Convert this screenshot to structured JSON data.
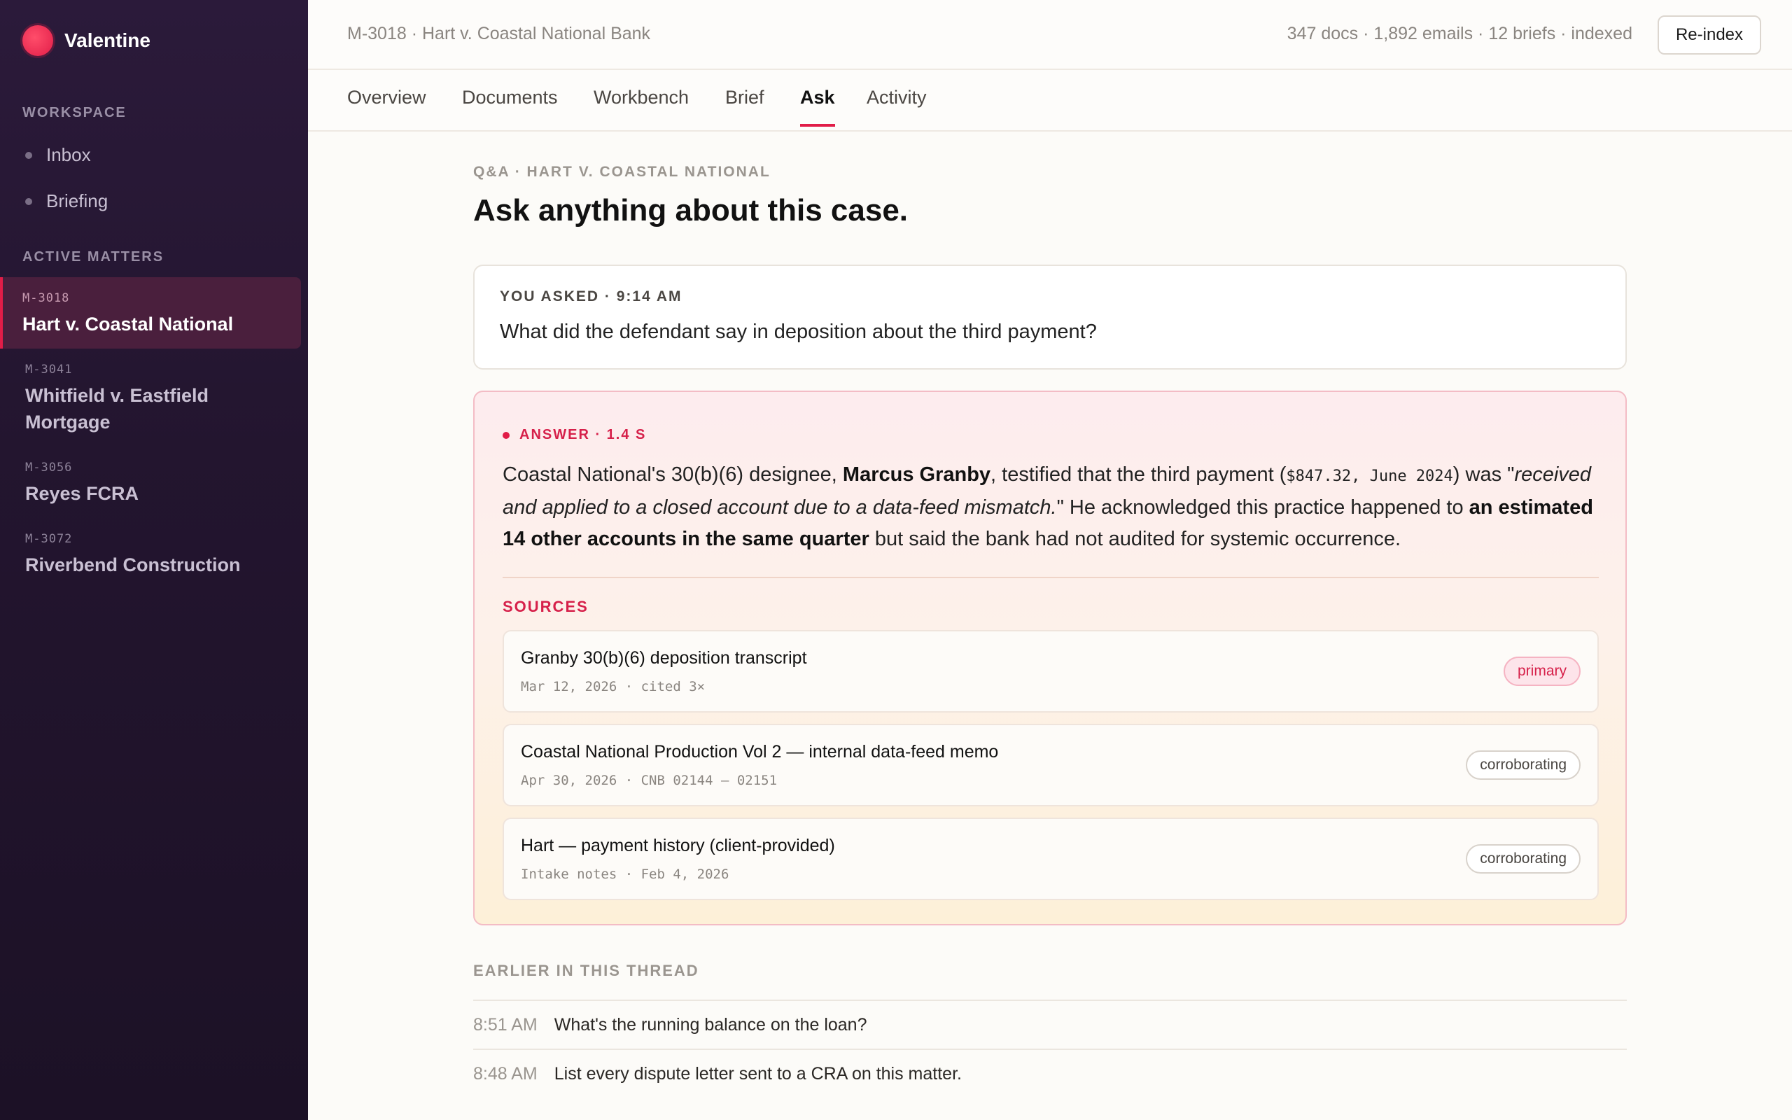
{
  "brand": {
    "name": "Valentine"
  },
  "sidebar": {
    "workspace_label": "WORKSPACE",
    "workspace_items": [
      {
        "label": "Inbox"
      },
      {
        "label": "Briefing"
      }
    ],
    "matters_label": "ACTIVE MATTERS",
    "matters": [
      {
        "code": "M-3018",
        "name": "Hart v. Coastal National",
        "active": true
      },
      {
        "code": "M-3041",
        "name": "Whitfield v. Eastfield Mortgage",
        "active": false
      },
      {
        "code": "M-3056",
        "name": "Reyes FCRA",
        "active": false
      },
      {
        "code": "M-3072",
        "name": "Riverbend Construction",
        "active": false
      }
    ]
  },
  "header": {
    "breadcrumb": "M-3018 · Hart v. Coastal National Bank",
    "stats": "347 docs · 1,892 emails · 12 briefs · indexed",
    "reindex_label": "Re-index"
  },
  "tabs": [
    {
      "label": "Overview"
    },
    {
      "label": "Documents"
    },
    {
      "label": "Workbench"
    },
    {
      "label": "Brief"
    },
    {
      "label": "Ask",
      "active": true
    },
    {
      "label": "Activity"
    }
  ],
  "main": {
    "eyebrow": "Q&A · HART V. COASTAL NATIONAL",
    "title": "Ask anything about this case.",
    "question": {
      "meta": "YOU ASKED · 9:14 AM",
      "text": "What did the defendant say in deposition about the third payment?"
    },
    "answer": {
      "meta": "ANSWER · 1.4 S",
      "p1": "Coastal National's 30(b)(6) designee, ",
      "name": "Marcus Granby",
      "p2": ", testified that the third payment (",
      "payment": "$847.32, June 2024",
      "p3": ") was \"",
      "quote": "received and applied to a closed account due to a data-feed mismatch.",
      "p4": "\" He acknowledged this practice happened to ",
      "emphasis": "an estimated 14 other accounts in the same quarter",
      "p5": " but said the bank had not audited for systemic occurrence."
    },
    "sources_label": "SOURCES",
    "sources": [
      {
        "title": "Granby 30(b)(6) deposition transcript",
        "meta": "Mar 12, 2026 · cited 3×",
        "badge": "primary"
      },
      {
        "title": "Coastal National Production Vol 2 — internal data-feed memo",
        "meta": "Apr 30, 2026 · CNB 02144 – 02151",
        "badge": "corroborating"
      },
      {
        "title": "Hart — payment history (client-provided)",
        "meta": "Intake notes · Feb 4, 2026",
        "badge": "corroborating"
      }
    ],
    "earlier_label": "EARLIER IN THIS THREAD",
    "thread": [
      {
        "time": "8:51 AM",
        "text": "What's the running balance on the loan?"
      },
      {
        "time": "8:48 AM",
        "text": "List every dispute letter sent to a CRA on this matter."
      }
    ]
  },
  "colors": {
    "accent": "#e11d48",
    "sidebar_bg": "#23152f",
    "page_bg": "#fcfbf8"
  }
}
